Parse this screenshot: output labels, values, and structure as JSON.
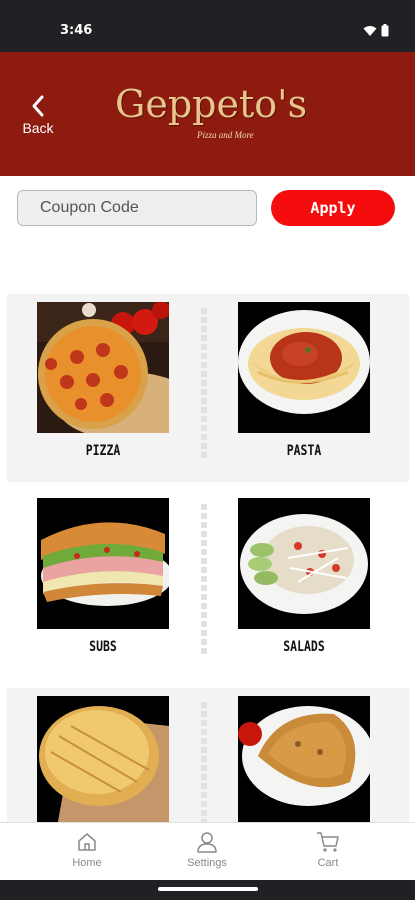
{
  "status_bar": {
    "time": "3:46"
  },
  "header": {
    "back_label": "Back",
    "brand_name": "Geppeto's",
    "brand_tagline": "Pizza and More",
    "background_color": "#8e1b10"
  },
  "coupon": {
    "placeholder": "Coupon Code",
    "value": "",
    "apply_label": "Apply",
    "apply_color": "#f50c0c"
  },
  "menu": {
    "items": [
      {
        "label": "PIZZA",
        "image": "pizza-photo"
      },
      {
        "label": "PASTA",
        "image": "pasta-photo"
      },
      {
        "label": "SUBS",
        "image": "subs-photo"
      },
      {
        "label": "SALADS",
        "image": "salads-photo"
      },
      {
        "label": "",
        "image": "breadsticks-photo"
      },
      {
        "label": "",
        "image": "calzone-photo"
      }
    ]
  },
  "bottom_nav": {
    "items": [
      {
        "label": "Home",
        "icon": "home-icon"
      },
      {
        "label": "Settings",
        "icon": "person-icon"
      },
      {
        "label": "Cart",
        "icon": "cart-icon"
      }
    ]
  }
}
